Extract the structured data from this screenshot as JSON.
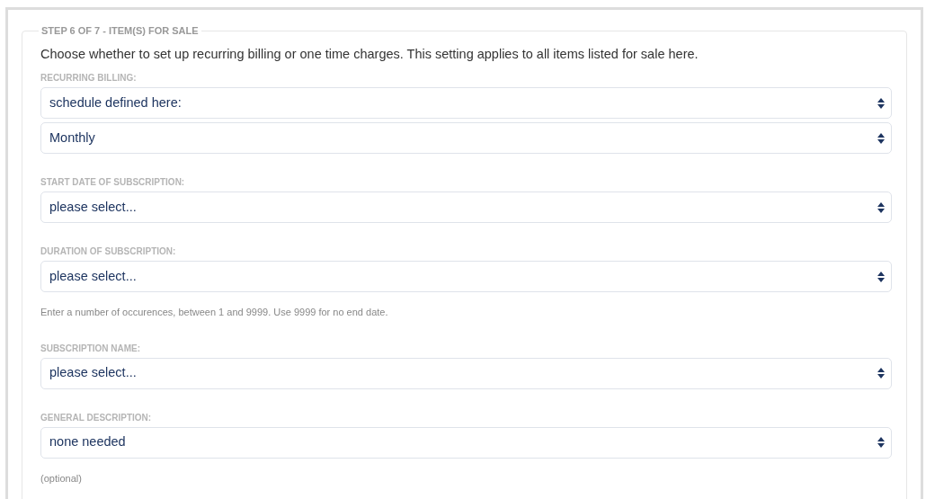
{
  "section": {
    "legend": "STEP 6 OF 7 - ITEM(S) FOR SALE",
    "intro": "Choose whether to set up recurring billing or one time charges. This setting applies to all items listed for sale here."
  },
  "fields": [
    {
      "label": "RECURRING BILLING:",
      "selects": [
        "schedule defined here:",
        "Monthly"
      ]
    },
    {
      "label": "START DATE OF SUBSCRIPTION:",
      "selects": [
        "please select..."
      ]
    },
    {
      "label": "DURATION OF SUBSCRIPTION:",
      "selects": [
        "please select..."
      ],
      "help": "Enter a number of occurences, between 1 and 9999. Use 9999 for no end date."
    },
    {
      "label": "SUBSCRIPTION NAME:",
      "selects": [
        "please select..."
      ]
    },
    {
      "label": "GENERAL DESCRIPTION:",
      "selects": [
        "none needed"
      ],
      "help": "(optional)"
    }
  ]
}
